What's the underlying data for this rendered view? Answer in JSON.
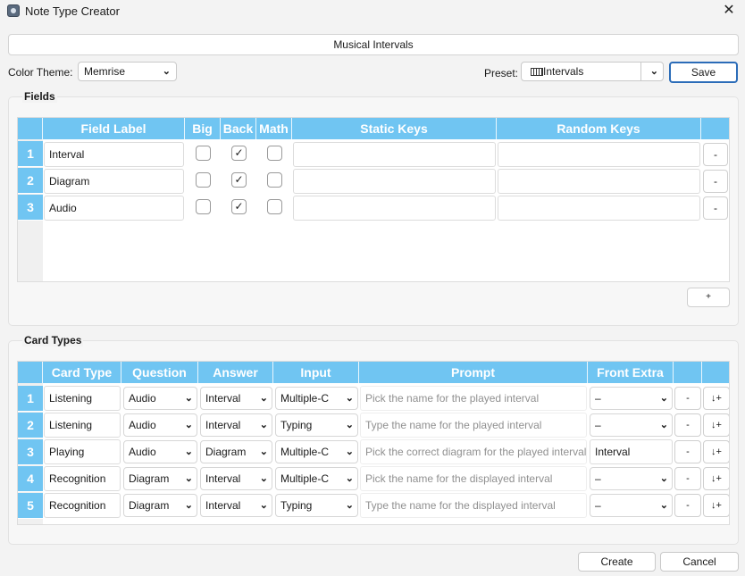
{
  "window": {
    "title": "Note Type Creator",
    "close_glyph": "✕"
  },
  "note_type_name": "Musical Intervals",
  "color_theme": {
    "label": "Color Theme:",
    "value": "Memrise"
  },
  "preset": {
    "label": "Preset:",
    "value": "Intervals",
    "icon": "piano-icon"
  },
  "save_label": "Save",
  "fields": {
    "group_title": "Fields",
    "headers": [
      "Field Label",
      "Big",
      "Back",
      "Math",
      "Static Keys",
      "Random Keys"
    ],
    "rows": [
      {
        "num": "1",
        "label": "Interval",
        "big": false,
        "back": true,
        "math": false,
        "static_keys": "",
        "random_keys": ""
      },
      {
        "num": "2",
        "label": "Diagram",
        "big": false,
        "back": true,
        "math": false,
        "static_keys": "",
        "random_keys": ""
      },
      {
        "num": "3",
        "label": "Audio",
        "big": false,
        "back": true,
        "math": false,
        "static_keys": "",
        "random_keys": ""
      }
    ],
    "remove_label": "-",
    "add_label": "+"
  },
  "card_types": {
    "group_title": "Card Types",
    "headers": [
      "Card Type",
      "Question",
      "Answer",
      "Input",
      "Prompt",
      "Front Extra"
    ],
    "rows": [
      {
        "num": "1",
        "card_type": "Listening",
        "question": "Audio",
        "answer": "Interval",
        "input": "Multiple-C",
        "prompt": "Pick the name for the played interval",
        "front_extra": "–"
      },
      {
        "num": "2",
        "card_type": "Listening",
        "question": "Audio",
        "answer": "Interval",
        "input": "Typing",
        "prompt": "Type the name for the played interval",
        "front_extra": "–"
      },
      {
        "num": "3",
        "card_type": "Playing",
        "question": "Audio",
        "answer": "Diagram",
        "input": "Multiple-C",
        "prompt": "Pick the correct diagram for the played interval",
        "front_extra": "Interval"
      },
      {
        "num": "4",
        "card_type": "Recognition",
        "question": "Diagram",
        "answer": "Interval",
        "input": "Multiple-C",
        "prompt": "Pick the name for the displayed interval",
        "front_extra": "–"
      },
      {
        "num": "5",
        "card_type": "Recognition",
        "question": "Diagram",
        "answer": "Interval",
        "input": "Typing",
        "prompt": "Type the name for the displayed interval",
        "front_extra": "–"
      }
    ],
    "remove_label": "-",
    "move_down_label": "↓+"
  },
  "footer": {
    "create_label": "Create",
    "cancel_label": "Cancel"
  },
  "colors": {
    "header_blue": "#70c5f2",
    "save_border": "#2b6cb8"
  }
}
